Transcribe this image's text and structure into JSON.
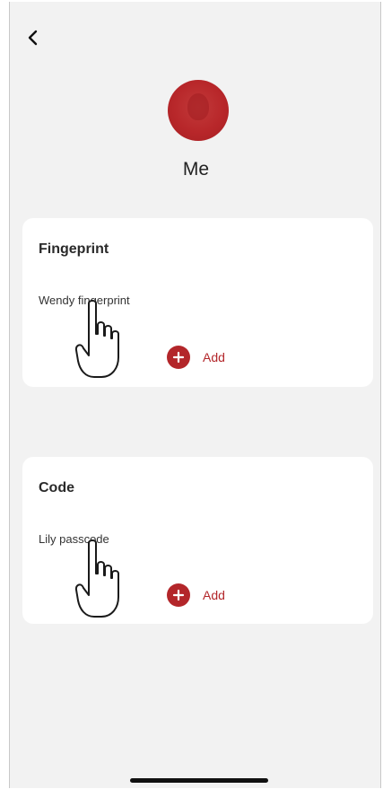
{
  "header": {
    "back_icon": "chevron-left-icon"
  },
  "profile": {
    "avatar_color": "#b8272a",
    "name": "Me"
  },
  "fingerprint_card": {
    "title": "Fingeprint",
    "items": [
      {
        "label": "Wendy fingerprint"
      }
    ],
    "add_label": "Add",
    "add_icon": "plus-circle-icon"
  },
  "code_card": {
    "title": "Code",
    "items": [
      {
        "label": "Lily passcode"
      }
    ],
    "add_label": "Add",
    "add_icon": "plus-circle-icon"
  },
  "colors": {
    "accent": "#b3262a",
    "background": "#f2f2f2",
    "card": "#ffffff"
  },
  "overlays": {
    "pointer_icon": "hand-pointer-icon"
  }
}
